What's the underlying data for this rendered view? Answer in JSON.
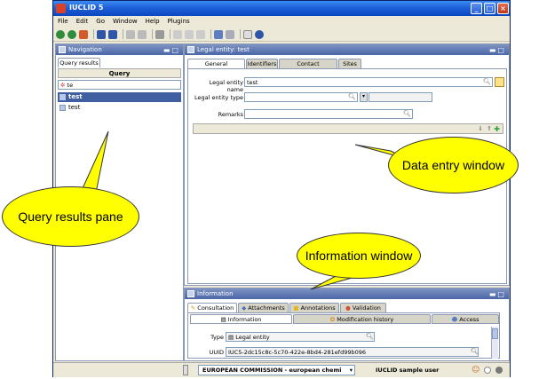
{
  "window": {
    "title": "IUCLID 5"
  },
  "menu": [
    "File",
    "Edit",
    "Go",
    "Window",
    "Help",
    "Plugins"
  ],
  "navigation": {
    "title": "Navigation",
    "tab": "Query results",
    "query_header": "Query",
    "query_value": "te",
    "results": [
      "test",
      "test"
    ]
  },
  "editor": {
    "title": "Legal entity: test",
    "tabs": [
      "General information",
      "Identifiers",
      "Contact information",
      "Sites"
    ],
    "fields": {
      "name_label": "Legal entity name",
      "name_value": "test",
      "type_label": "Legal entity type",
      "remarks_label": "Remarks"
    }
  },
  "information": {
    "title": "Information",
    "tabs": [
      "Consultation",
      "Attachments",
      "Annotations",
      "Validation"
    ],
    "subtabs": [
      "Information",
      "Modification history",
      "Access"
    ],
    "type_label": "Type",
    "type_value": "Legal entity",
    "uuid_label": "UUID",
    "uuid_value": "IUC5-2dc15c8c-5c70-422e-8bd4-281efd99b096"
  },
  "statusbar": {
    "org": "EUROPEAN COMMISSION - european chemi",
    "user": "IUCLID sample user"
  },
  "callouts": {
    "data_entry": "Data entry window",
    "query_results": "Query results pane",
    "information": "Information window"
  },
  "colors": {
    "callout": "#ffff00",
    "panel_header": "#4b67a8",
    "selection": "#3f5fa0"
  }
}
